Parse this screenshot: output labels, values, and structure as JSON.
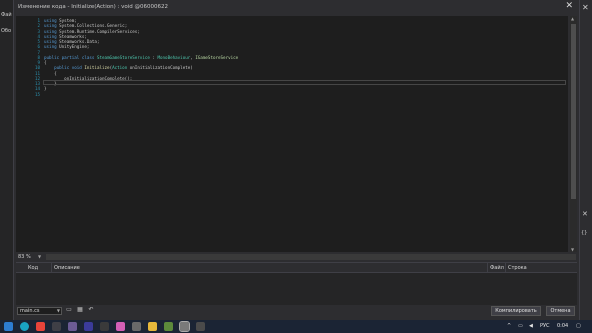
{
  "window": {
    "title": "Изменение кода - Initialize(Action) : void @06000622"
  },
  "background_app": {
    "left_labels": [
      "Фай",
      "Обо"
    ]
  },
  "editor": {
    "lines": [
      {
        "num": "1",
        "tokens": [
          {
            "t": "using ",
            "c": "#569cd6"
          },
          {
            "t": "System;",
            "c": "#c8c8c8"
          }
        ]
      },
      {
        "num": "2",
        "tokens": [
          {
            "t": "using ",
            "c": "#569cd6"
          },
          {
            "t": "System.Collections.Generic;",
            "c": "#c8c8c8"
          }
        ]
      },
      {
        "num": "3",
        "tokens": [
          {
            "t": "using ",
            "c": "#569cd6"
          },
          {
            "t": "System.Runtime.CompilerServices;",
            "c": "#c8c8c8"
          }
        ]
      },
      {
        "num": "4",
        "tokens": [
          {
            "t": "using ",
            "c": "#569cd6"
          },
          {
            "t": "Steamworks;",
            "c": "#c8c8c8"
          }
        ]
      },
      {
        "num": "5",
        "tokens": [
          {
            "t": "using ",
            "c": "#569cd6"
          },
          {
            "t": "Steamworks.Data;",
            "c": "#c8c8c8"
          }
        ]
      },
      {
        "num": "6",
        "tokens": [
          {
            "t": "using ",
            "c": "#569cd6"
          },
          {
            "t": "UnityEngine;",
            "c": "#c8c8c8"
          }
        ]
      },
      {
        "num": "7",
        "tokens": []
      },
      {
        "num": "8",
        "tokens": [
          {
            "t": "public partial class ",
            "c": "#569cd6"
          },
          {
            "t": "SteamGameStoreService",
            "c": "#4ec9b0"
          },
          {
            "t": " : ",
            "c": "#c8c8c8"
          },
          {
            "t": "MonoBehaviour",
            "c": "#4ec9b0"
          },
          {
            "t": ", ",
            "c": "#c8c8c8"
          },
          {
            "t": "IGameStoreService",
            "c": "#b8d7a3"
          }
        ]
      },
      {
        "num": "9",
        "tokens": [
          {
            "t": "{",
            "c": "#c8c8c8"
          }
        ]
      },
      {
        "num": "10",
        "tokens": [
          {
            "t": "    public void ",
            "c": "#569cd6"
          },
          {
            "t": "Initialize",
            "c": "#dcdcaa"
          },
          {
            "t": "(",
            "c": "#c8c8c8"
          },
          {
            "t": "Action",
            "c": "#4ec9b0"
          },
          {
            "t": " onInitializationComplete)",
            "c": "#c8c8c8"
          }
        ]
      },
      {
        "num": "11",
        "tokens": [
          {
            "t": "    {",
            "c": "#c8c8c8"
          }
        ]
      },
      {
        "num": "12",
        "tokens": [
          {
            "t": "        onInitializationComplete();",
            "c": "#c8c8c8"
          }
        ]
      },
      {
        "num": "13",
        "tokens": [
          {
            "t": "    }",
            "c": "#c8c8c8"
          }
        ]
      },
      {
        "num": "14",
        "tokens": [
          {
            "t": "}",
            "c": "#c8c8c8"
          }
        ]
      },
      {
        "num": "15",
        "tokens": []
      }
    ]
  },
  "zoom": {
    "value": "83 %"
  },
  "error_list": {
    "columns": [
      "Код",
      "Описание",
      "Файл",
      "Строка"
    ]
  },
  "bottom": {
    "file_name": "main.cs",
    "compile_label": "Компилировать",
    "cancel_label": "Отмена"
  },
  "taskbar": {
    "language": "РУС",
    "time": "0:04"
  }
}
